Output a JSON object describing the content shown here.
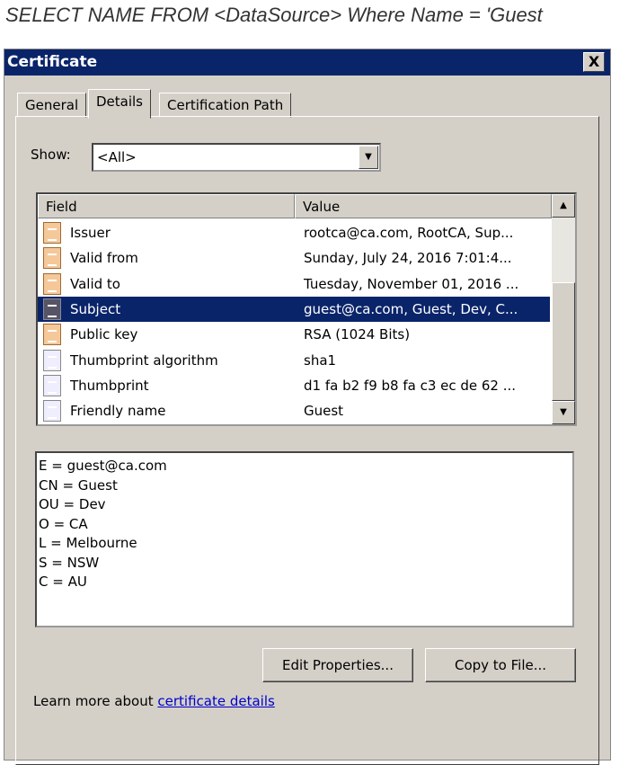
{
  "caption": "SELECT NAME FROM <DataSource> Where Name = 'Guest",
  "window": {
    "title": "Certificate",
    "close": "X"
  },
  "tabs": [
    "General",
    "Details",
    "Certification Path"
  ],
  "show": {
    "label": "Show:",
    "value": "<All>"
  },
  "list": {
    "headers": [
      "Field",
      "Value"
    ],
    "rows": [
      {
        "field": "Issuer",
        "value": "rootca@ca.com, RootCA, Sup...",
        "icon": "cert-field"
      },
      {
        "field": "Valid from",
        "value": "Sunday, July 24, 2016 7:01:4...",
        "icon": "cert-field"
      },
      {
        "field": "Valid to",
        "value": "Tuesday, November 01, 2016 ...",
        "icon": "cert-field"
      },
      {
        "field": "Subject",
        "value": "guest@ca.com, Guest, Dev, C...",
        "icon": "cert-field",
        "selected": true
      },
      {
        "field": "Public key",
        "value": "RSA (1024 Bits)",
        "icon": "cert-field"
      },
      {
        "field": "Thumbprint algorithm",
        "value": "sha1",
        "icon": "property"
      },
      {
        "field": "Thumbprint",
        "value": "d1 fa b2 f9 b8 fa c3 ec de 62 ...",
        "icon": "property"
      },
      {
        "field": "Friendly name",
        "value": "Guest",
        "icon": "property"
      }
    ]
  },
  "details": [
    "E = guest@ca.com",
    "CN = Guest",
    "OU = Dev",
    "O = CA",
    "L = Melbourne",
    "S = NSW",
    "C = AU"
  ],
  "buttons": {
    "edit": "Edit Properties...",
    "copy": "Copy to File..."
  },
  "learn": {
    "text": "Learn more about ",
    "link": "certificate details"
  }
}
